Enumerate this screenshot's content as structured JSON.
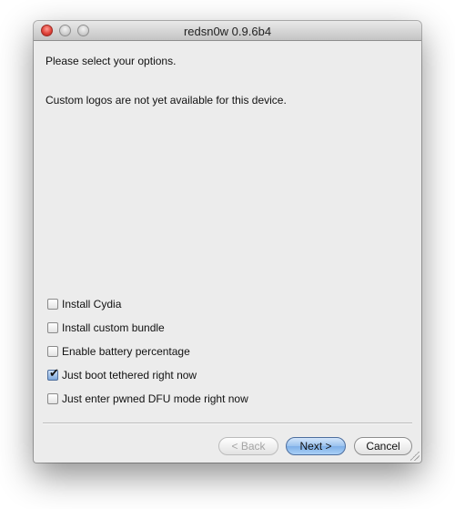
{
  "window": {
    "title": "redsn0w 0.9.6b4"
  },
  "content": {
    "prompt": "Please select your options.",
    "notice": "Custom logos are not yet available for this device."
  },
  "options": [
    {
      "label": "Install Cydia",
      "checked": false
    },
    {
      "label": "Install custom bundle",
      "checked": false
    },
    {
      "label": "Enable battery percentage",
      "checked": false
    },
    {
      "label": "Just boot tethered right now",
      "checked": true
    },
    {
      "label": "Just enter pwned DFU mode right now",
      "checked": false
    }
  ],
  "buttons": {
    "back_label": "< Back",
    "back_enabled": false,
    "next_label": "Next >",
    "cancel_label": "Cancel"
  },
  "colors": {
    "close_button": "#e0443b",
    "default_button": "#7fb0e8",
    "window_background": "#ececec"
  }
}
